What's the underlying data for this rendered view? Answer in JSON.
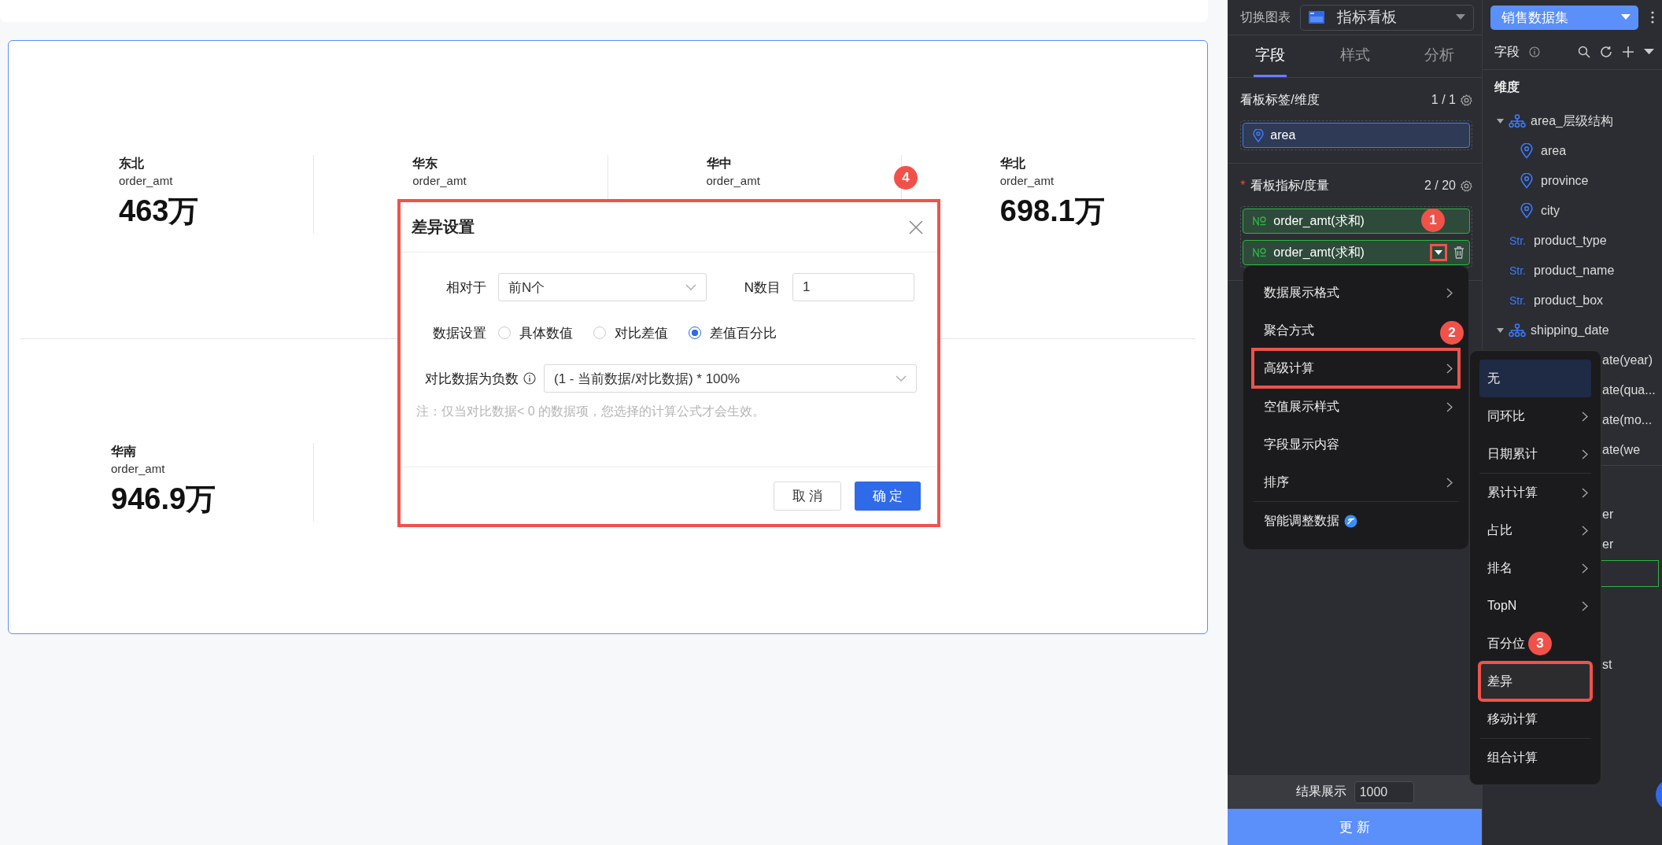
{
  "dashboard": {
    "kpis": [
      {
        "region": "东北",
        "measure": "order_amt",
        "value": "463万"
      },
      {
        "region": "华东",
        "measure": "order_amt"
      },
      {
        "region": "华中",
        "measure": "order_amt"
      },
      {
        "region": "华北",
        "measure": "order_amt",
        "value": "698.1万"
      },
      {
        "region": "华南",
        "measure": "order_amt",
        "value": "946.9万"
      }
    ]
  },
  "dialog": {
    "title": "差异设置",
    "marked": true,
    "relative_label": "相对于",
    "relative_value": "前N个",
    "n_label": "N数目",
    "n_value": "1",
    "data_label": "数据设置",
    "options": [
      {
        "label": "具体数值",
        "selected": false
      },
      {
        "label": "对比差值",
        "selected": false
      },
      {
        "label": "差值百分比",
        "selected": true
      }
    ],
    "negative_label": "对比数据为负数",
    "negative_value": "(1 - 当前数据/对比数据) * 100%",
    "note": "注：仅当对比数据< 0 的数据项，您选择的计算公式才会生效。",
    "buttons": [
      {
        "label": "取 消",
        "kind": "secondary"
      },
      {
        "label": "确 定",
        "kind": "primary"
      }
    ]
  },
  "config_panel": {
    "chart_label": "切换图表",
    "chart_value": "指标看板",
    "tabs": [
      {
        "label": "字段",
        "selected": true
      },
      {
        "label": "样式",
        "selected": false
      },
      {
        "label": "分析",
        "selected": false
      }
    ],
    "sections": [
      {
        "title": "看板标签/维度",
        "count": "1 / 1",
        "fields": [
          {
            "label": "area",
            "kind": "dimension",
            "hovered": false
          }
        ]
      },
      {
        "title": "看板指标/度量",
        "required_mark": "*",
        "count": "2 / 20",
        "fields": [
          {
            "label": "order_amt(求和)",
            "kind": "measure",
            "hovered": false
          },
          {
            "label": "order_amt(求和)",
            "kind": "measure",
            "hovered": true,
            "caret_marked": true
          }
        ]
      }
    ],
    "result_label": "结果展示",
    "result_value": "1000",
    "update_button": "更 新"
  },
  "field_panel": {
    "dataset": "销售数据集",
    "title": "字段",
    "group": "维度",
    "tree": [
      {
        "label": "area_层级结构",
        "kind": "hierarchy",
        "expanded": true,
        "children": [
          {
            "label": "area",
            "kind": "geo"
          },
          {
            "label": "province",
            "kind": "geo"
          },
          {
            "label": "city",
            "kind": "geo"
          }
        ]
      },
      {
        "label": "product_type",
        "kind": "string",
        "type_label": "Str."
      },
      {
        "label": "product_name",
        "kind": "string",
        "type_label": "Str."
      },
      {
        "label": "product_box",
        "kind": "string",
        "type_label": "Str."
      },
      {
        "label": "shipping_date",
        "kind": "hierarchy",
        "expanded": true,
        "children": [
          {
            "label": "ate(year)",
            "kind": "partial"
          },
          {
            "label": "ate(qua...",
            "kind": "partial"
          },
          {
            "label": "ate(mo...",
            "kind": "partial"
          },
          {
            "label": "ate(we",
            "kind": "partial"
          }
        ]
      }
    ],
    "lower_rows": [
      {
        "kind": "text",
        "label": "er"
      },
      {
        "kind": "text",
        "label": "er"
      },
      {
        "kind": "drop-zone"
      },
      {
        "kind": "text",
        "label": "st"
      }
    ]
  },
  "context_menu": {
    "groups": [
      {
        "items": [
          {
            "label": "数据展示格式",
            "kind": "submenu",
            "marked": false
          },
          {
            "label": "聚合方式",
            "kind": "plain",
            "marked": false
          },
          {
            "label": "高级计算",
            "kind": "submenu",
            "marked": true
          }
        ]
      },
      {
        "items": [
          {
            "label": "空值展示样式",
            "kind": "submenu",
            "marked": false
          },
          {
            "label": "字段显示内容",
            "kind": "plain",
            "marked": false
          },
          {
            "label": "排序",
            "kind": "submenu",
            "marked": false
          }
        ]
      },
      {
        "items": [
          {
            "label": "智能调整数据",
            "kind": "ai",
            "marked": false
          }
        ]
      }
    ]
  },
  "submenu": {
    "groups": [
      {
        "items": [
          {
            "label": "无",
            "kind": "plain",
            "selected": true,
            "marked": false
          },
          {
            "label": "同环比",
            "kind": "submenu",
            "selected": false,
            "marked": false
          },
          {
            "label": "日期累计",
            "kind": "submenu",
            "selected": false,
            "marked": false
          }
        ]
      },
      {
        "items": [
          {
            "label": "累计计算",
            "kind": "submenu",
            "selected": false,
            "marked": false
          },
          {
            "label": "占比",
            "kind": "submenu",
            "selected": false,
            "marked": false
          },
          {
            "label": "排名",
            "kind": "submenu",
            "selected": false,
            "marked": false
          },
          {
            "label": "TopN",
            "kind": "submenu",
            "selected": false,
            "marked": false
          },
          {
            "label": "百分位",
            "kind": "plain",
            "selected": false,
            "marked": false
          },
          {
            "label": "差异",
            "kind": "plain",
            "selected": false,
            "marked": true
          },
          {
            "label": "移动计算",
            "kind": "plain",
            "selected": false,
            "marked": false
          }
        ]
      },
      {
        "items": [
          {
            "label": "组合计算",
            "kind": "plain",
            "selected": false,
            "marked": false
          }
        ]
      }
    ]
  },
  "step_badges": [
    {
      "label": "1"
    },
    {
      "label": "2"
    },
    {
      "label": "3"
    },
    {
      "label": "4"
    }
  ]
}
